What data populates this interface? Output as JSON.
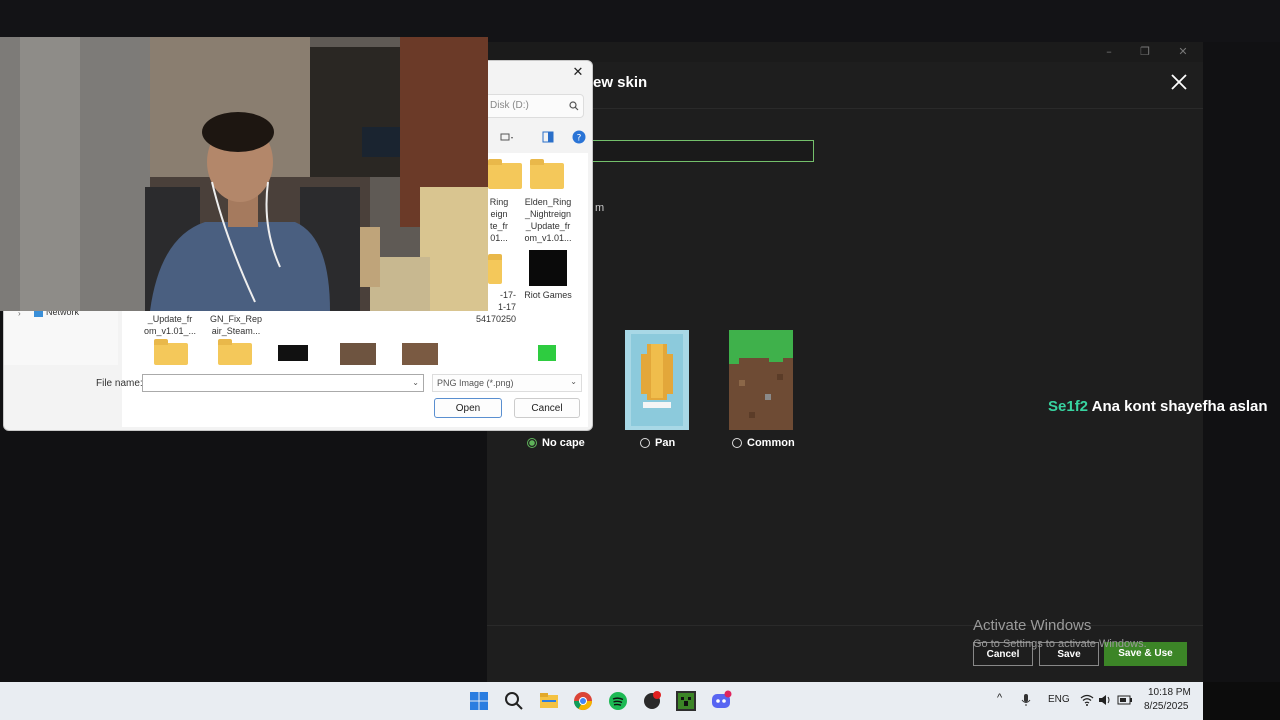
{
  "launcher": {
    "title": "ew skin",
    "m_fragment": "m",
    "capes": [
      {
        "label": "No cape",
        "selected": true
      },
      {
        "label": "Pan",
        "selected": false
      },
      {
        "label": "Common",
        "selected": false
      }
    ],
    "footer": {
      "cancel": "Cancel",
      "save": "Save",
      "save_use": "Save & Use"
    }
  },
  "chat": {
    "user": "Se1f2",
    "message": "Ana kont shayefha aslan"
  },
  "watermark": {
    "title": "Activate Windows",
    "sub": "Go to Settings to activate Windows."
  },
  "dialog": {
    "address": "Disk (D:)",
    "items": [
      {
        "name": "Ring\neign\nte_fr\n01..."
      },
      {
        "name": "Elden_Ring\n_Nightreign\n_Update_fr\nom_v1.01..."
      },
      {
        "name": "-17-\n1-17\n54170250"
      },
      {
        "name": "Riot Games"
      },
      {
        "name": "_Update_fr\nom_v1.01_..."
      },
      {
        "name": "GN_Fix_Rep\nair_Steam..."
      }
    ],
    "nav_network": "Network",
    "filename_label": "File name:",
    "filename_value": "",
    "filetype": "PNG Image (*.png)",
    "open": "Open",
    "cancel": "Cancel"
  },
  "taskbar": {
    "lang": "ENG",
    "time": "10:18 PM",
    "date": "8/25/2025"
  },
  "colors": {
    "accent_green": "#3c8527",
    "chat_user": "#38d3a0",
    "input_border": "#74c06b"
  }
}
